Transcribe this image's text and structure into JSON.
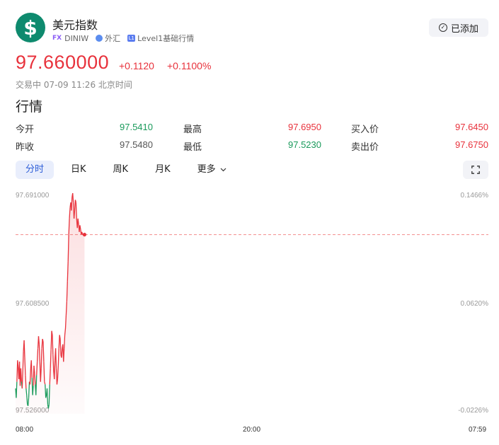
{
  "header": {
    "logo_symbol": "$",
    "name": "美元指数",
    "tag_fx": "FX",
    "code": "DINIW",
    "market": "外汇",
    "level_badge": "L1",
    "level": "Level1基础行情",
    "added_label": "已添加",
    "added_icon": "check-circle-icon"
  },
  "quote": {
    "price": "97.660000",
    "change": "+0.1120",
    "change_pct": "+0.1100%",
    "status": "交易中 07-09 11:26 北京时间"
  },
  "section_title": "行情",
  "stats": {
    "row1": [
      {
        "label": "今开",
        "value": "97.5410",
        "tone": "green"
      },
      {
        "label": "最高",
        "value": "97.6950",
        "tone": "red"
      },
      {
        "label": "买入价",
        "value": "97.6450",
        "tone": "red"
      }
    ],
    "row2": [
      {
        "label": "昨收",
        "value": "97.5480",
        "tone": "gray"
      },
      {
        "label": "最低",
        "value": "97.5230",
        "tone": "green"
      },
      {
        "label": "卖出价",
        "value": "97.6750",
        "tone": "red"
      }
    ]
  },
  "tabs": [
    "分时",
    "日K",
    "周K",
    "月K",
    "更多"
  ],
  "active_tab": "分时",
  "colors": {
    "up": "#e8323c",
    "down": "#1a9a5b",
    "ref_line": "#f28c8c"
  },
  "chart_data": {
    "type": "line",
    "y_left_ticks": [
      "97.691000",
      "97.608500",
      "97.526000"
    ],
    "y_right_ticks": [
      "0.1466%",
      "0.0620%",
      "-0.0226%"
    ],
    "x_ticks": [
      "08:00",
      "20:00",
      "07:59"
    ],
    "ylim": [
      97.526,
      97.691
    ],
    "prev_close": 97.548,
    "reference_price": 97.66,
    "series": [
      {
        "x_minutes": [
          0,
          2,
          4,
          6,
          8,
          10,
          12,
          14,
          16,
          18,
          20,
          22,
          24,
          26,
          28,
          30,
          32,
          34,
          36,
          38,
          40,
          42,
          44,
          46,
          48,
          50,
          52,
          54,
          56,
          58,
          60,
          62,
          64,
          66,
          68,
          70,
          72,
          74,
          76,
          78,
          80,
          82,
          84,
          86,
          88,
          90,
          92,
          94,
          96,
          98,
          100,
          102,
          104,
          106,
          108,
          110,
          112,
          114,
          116,
          118,
          120,
          122,
          124,
          126,
          128,
          130,
          132,
          134,
          136,
          138,
          140,
          142,
          144,
          146,
          148,
          150,
          152,
          154,
          156,
          158,
          160,
          162,
          164,
          166,
          168,
          170,
          172,
          174,
          176,
          178,
          180,
          182,
          184,
          186,
          188,
          190,
          192,
          194,
          196,
          198,
          200,
          202,
          204,
          206,
          208,
          210
        ],
        "values": [
          97.545,
          97.538,
          97.55,
          97.566,
          97.561,
          97.552,
          97.565,
          97.547,
          97.56,
          97.55,
          97.545,
          97.558,
          97.573,
          97.581,
          97.568,
          97.555,
          97.545,
          97.54,
          97.533,
          97.532,
          97.538,
          97.55,
          97.548,
          97.56,
          97.566,
          97.553,
          97.54,
          97.547,
          97.562,
          97.556,
          97.548,
          97.54,
          97.555,
          97.565,
          97.575,
          97.584,
          97.578,
          97.565,
          97.55,
          97.56,
          97.575,
          97.582,
          97.58,
          97.565,
          97.55,
          97.548,
          97.538,
          97.54,
          97.545,
          97.533,
          97.53,
          97.533,
          97.548,
          97.56,
          97.574,
          97.588,
          97.585,
          97.57,
          97.558,
          97.552,
          97.566,
          97.575,
          97.56,
          97.548,
          97.552,
          97.562,
          97.575,
          97.585,
          97.582,
          97.57,
          97.568,
          97.575,
          97.578,
          97.565,
          97.575,
          97.585,
          97.59,
          97.6,
          97.61,
          97.625,
          97.64,
          97.66,
          97.672,
          97.68,
          97.684,
          97.678,
          97.688,
          97.691,
          97.684,
          97.672,
          97.678,
          97.686,
          97.684,
          97.672,
          97.665,
          97.672,
          97.668,
          97.662,
          97.667,
          97.664,
          97.66,
          97.662,
          97.66,
          97.66,
          97.66,
          97.66
        ]
      }
    ]
  }
}
